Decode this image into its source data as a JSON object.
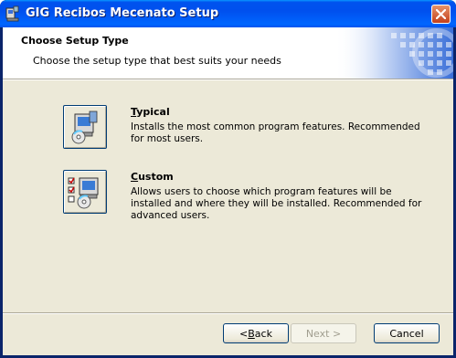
{
  "window": {
    "title": "GIG Recibos Mecenato Setup"
  },
  "banner": {
    "title": "Choose Setup Type",
    "subtitle": "Choose the setup type that best suits your needs"
  },
  "options": [
    {
      "accel": "T",
      "rest": "ypical",
      "description": "Installs the most common program features. Recommended for most users.",
      "icon": "typical-setup-icon"
    },
    {
      "accel": "C",
      "rest": "ustom",
      "description": "Allows users to choose which program features will be installed and where they will be installed. Recommended for advanced users.",
      "icon": "custom-setup-icon"
    }
  ],
  "buttons": {
    "back_pre": "< ",
    "back_accel": "B",
    "back_rest": "ack",
    "next": "Next >",
    "cancel": "Cancel"
  },
  "colors": {
    "titlebar": "#0054e3",
    "face": "#ece9d8",
    "close": "#c4401c"
  }
}
